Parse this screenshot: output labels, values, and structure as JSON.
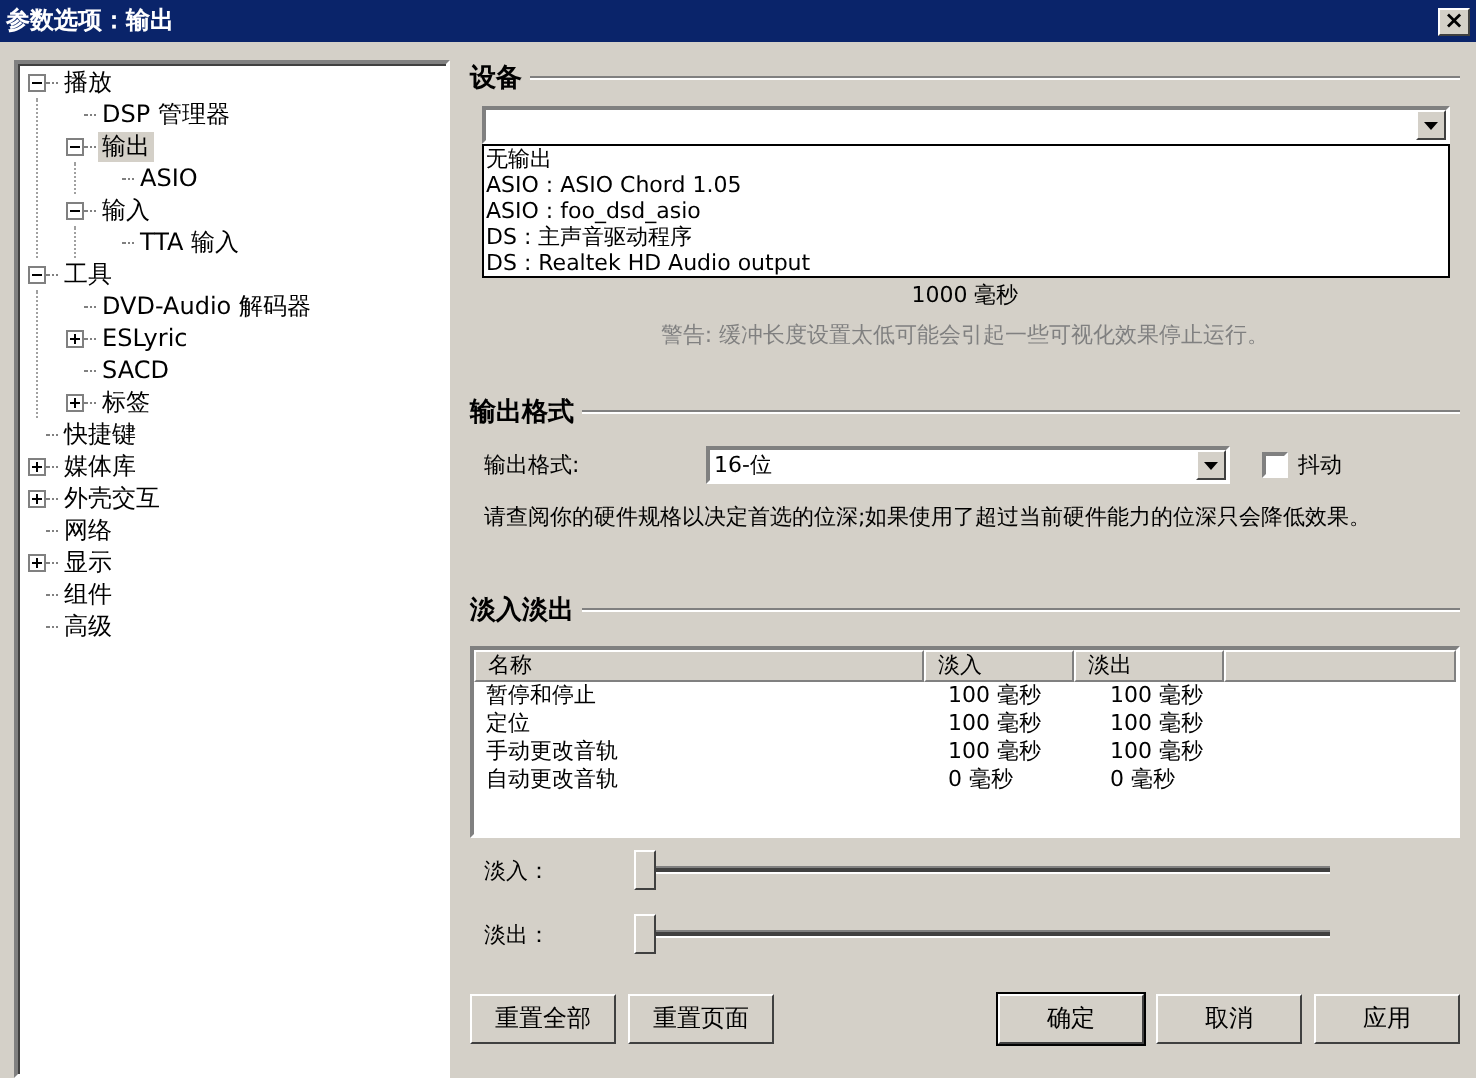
{
  "window": {
    "title": "参数选项：输出",
    "close": "×"
  },
  "tree": [
    {
      "label": "播放",
      "expanded": true,
      "selected": false,
      "children": [
        {
          "label": "DSP 管理器",
          "selected": false
        },
        {
          "label": "输出",
          "expanded": true,
          "selected": true,
          "children": [
            {
              "label": "ASIO",
              "selected": false
            }
          ]
        },
        {
          "label": "输入",
          "expanded": true,
          "selected": false,
          "children": [
            {
              "label": "TTA 输入",
              "selected": false
            }
          ]
        }
      ]
    },
    {
      "label": "工具",
      "expanded": true,
      "selected": false,
      "children": [
        {
          "label": "DVD-Audio 解码器",
          "selected": false
        },
        {
          "label": "ESLyric",
          "expanded": false,
          "selected": false
        },
        {
          "label": "SACD",
          "selected": false
        },
        {
          "label": "标签",
          "expanded": false,
          "selected": false
        }
      ]
    },
    {
      "label": "快捷键",
      "selected": false
    },
    {
      "label": "媒体库",
      "expanded": false,
      "selected": false
    },
    {
      "label": "外壳交互",
      "expanded": false,
      "selected": false
    },
    {
      "label": "网络",
      "selected": false
    },
    {
      "label": "显示",
      "expanded": false,
      "selected": false
    },
    {
      "label": "组件",
      "selected": false
    },
    {
      "label": "高级",
      "selected": false
    }
  ],
  "device": {
    "heading": "设备",
    "open": true,
    "options": [
      "无输出",
      "ASIO : ASIO Chord  1.05",
      "ASIO : foo_dsd_asio",
      "DS : 主声音驱动程序",
      "DS : Realtek HD Audio output"
    ]
  },
  "buffer": {
    "reading": "1000 毫秒",
    "warning": "警告: 缓冲长度设置太低可能会引起一些可视化效果停止运行。",
    "warning_disabled": true
  },
  "output_format": {
    "heading": "输出格式",
    "label": "输出格式:",
    "value": "16-位",
    "dither": {
      "label": "抖动",
      "checked": false
    },
    "note": "请查阅你的硬件规格以决定首选的位深;如果使用了超过当前硬件能力的位深只会降低效果。"
  },
  "fade": {
    "heading": "淡入淡出",
    "columns": [
      "名称",
      "淡入",
      "淡出"
    ],
    "rows": [
      {
        "cells": [
          "暂停和停止",
          "100 毫秒",
          "100 毫秒"
        ]
      },
      {
        "cells": [
          "定位",
          "100 毫秒",
          "100 毫秒"
        ]
      },
      {
        "cells": [
          "手动更改音轨",
          "100 毫秒",
          "100 毫秒"
        ]
      },
      {
        "cells": [
          "自动更改音轨",
          "0 毫秒",
          "0 毫秒"
        ]
      }
    ],
    "sliders": [
      {
        "label": "淡入：",
        "level": 0
      },
      {
        "label": "淡出：",
        "level": 0
      }
    ]
  },
  "buttons": [
    {
      "label": "重置全部",
      "kind": "left",
      "default": false
    },
    {
      "label": "重置页面",
      "kind": "left",
      "default": false
    },
    {
      "label": "确定",
      "kind": "right",
      "default": true
    },
    {
      "label": "取消",
      "kind": "right",
      "default": false
    },
    {
      "label": "应用",
      "kind": "right",
      "default": false
    }
  ]
}
